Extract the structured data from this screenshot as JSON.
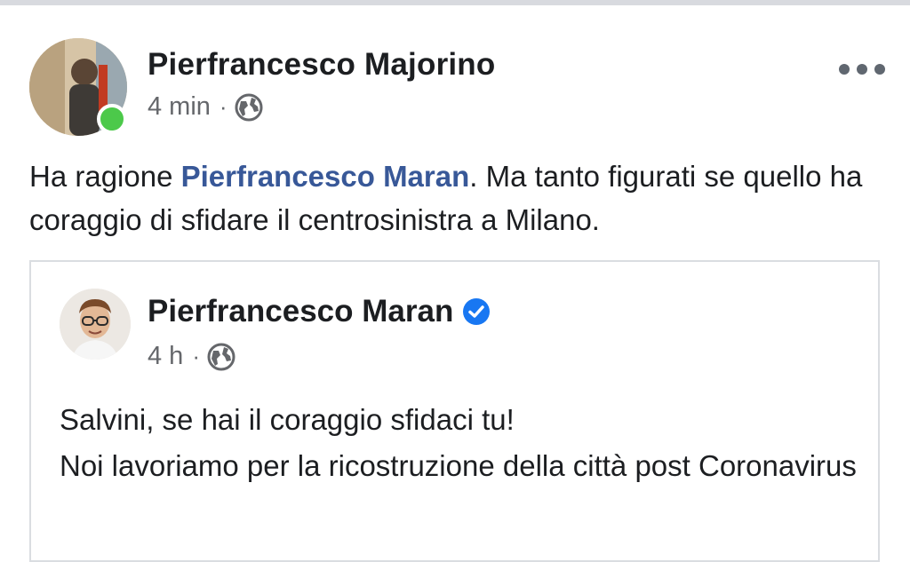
{
  "post": {
    "author": "Pierfrancesco Majorino",
    "time": "4 min",
    "separator": "·",
    "privacy_icon": "globe-icon",
    "online_indicator_color": "#4cc94a",
    "more_icon": "more-horizontal-icon",
    "text_before": "Ha ragione ",
    "mention": "Pierfrancesco Maran",
    "text_after": ". Ma tanto figurati se quello ha coraggio di sfidare il centrosinistra a Milano."
  },
  "shared_post": {
    "author": "Pierfrancesco Maran",
    "verified_icon": "verified-badge-icon",
    "time": "4 h",
    "separator": "·",
    "privacy_icon": "globe-icon",
    "line1": "Salvini, se hai il coraggio sfidaci tu!",
    "line2": "Noi lavoriamo per la ricostruzione della città post Coronavirus"
  },
  "colors": {
    "mention": "#385898",
    "secondary_text": "#65676b",
    "verified": "#1877f2",
    "border": "#dadde1"
  }
}
